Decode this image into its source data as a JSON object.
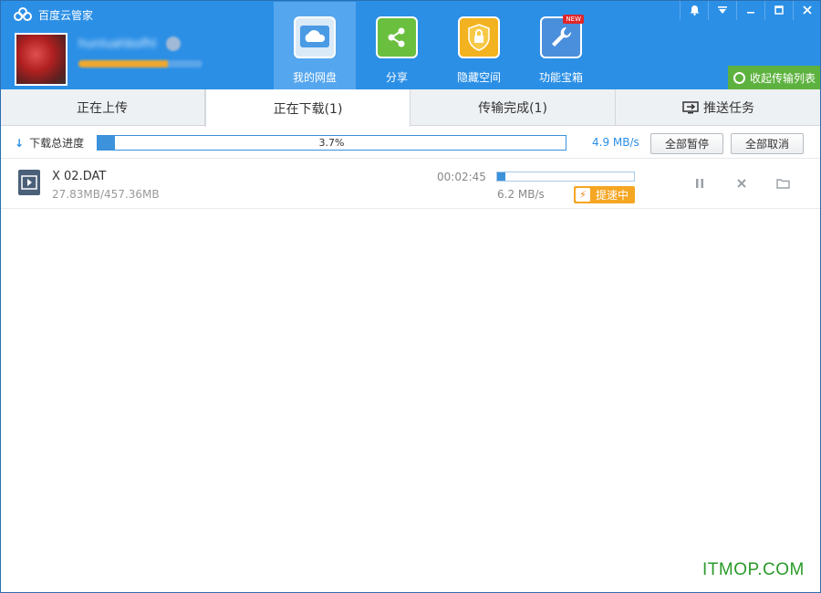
{
  "app": {
    "title": "百度云管家"
  },
  "user": {
    "name": "hunluahbofhl"
  },
  "nav": [
    {
      "label": "我的网盘",
      "icon": "cloud-icon",
      "active": true
    },
    {
      "label": "分享",
      "icon": "share-icon",
      "active": false
    },
    {
      "label": "隐藏空间",
      "icon": "lock-icon",
      "active": false
    },
    {
      "label": "功能宝箱",
      "icon": "wrench-icon",
      "active": false,
      "badge": "NEW"
    }
  ],
  "window_controls": [
    "bell-icon",
    "menu-icon",
    "minimize-icon",
    "maximize-icon",
    "close-icon"
  ],
  "collapse_button": "收起传输列表",
  "tabs": [
    {
      "label": "正在上传",
      "active": false
    },
    {
      "label": "正在下载(1)",
      "active": true
    },
    {
      "label": "传输完成(1)",
      "active": false
    },
    {
      "label": "推送任务",
      "active": false,
      "icon": "push-icon"
    }
  ],
  "overall": {
    "label": "下载总进度",
    "percent_text": "3.7%",
    "percent": 3.7,
    "speed": "4.9 MB/s",
    "pause_all": "全部暂停",
    "cancel_all": "全部取消"
  },
  "task": {
    "name": "X  02.DAT",
    "size": "27.83MB/457.36MB",
    "eta": "00:02:45",
    "progress": 6.1,
    "speed": "6.2 MB/s",
    "boost_label": "提速中"
  },
  "watermark": "ITMOP.COM",
  "colors": {
    "header": "#2b8fe6",
    "accent": "#3d92dc",
    "boost": "#f5a623",
    "collapse": "#5db23f",
    "watermark": "#2a9a2a"
  }
}
